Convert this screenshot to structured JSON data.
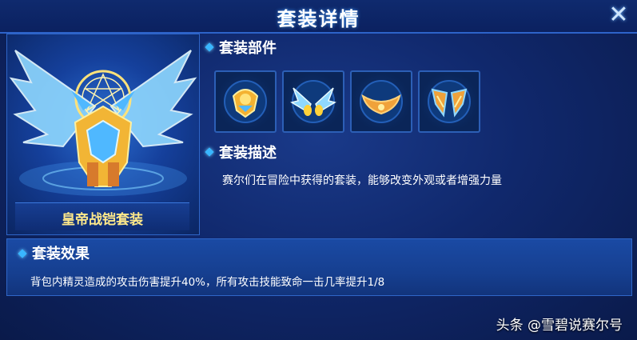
{
  "dialog": {
    "title": "套装详情",
    "close_icon": "close-icon"
  },
  "hero": {
    "suit_name": "皇帝战铠套装",
    "accent": "#ffe98a"
  },
  "parts_section": {
    "title": "套装部件",
    "parts": [
      {
        "icon": "helmet-icon"
      },
      {
        "icon": "wings-icon"
      },
      {
        "icon": "cape-icon"
      },
      {
        "icon": "armor-wings-icon"
      }
    ]
  },
  "description_section": {
    "title": "套装描述",
    "text": "赛尔们在冒险中获得的套装，能够改变外观或者增强力量"
  },
  "effects_section": {
    "title": "套装效果",
    "text": "背包内精灵造成的攻击伤害提升40%，所有攻击技能致命一击几率提升1/8"
  },
  "watermark": "头条 @雪碧说赛尔号",
  "colors": {
    "background": "#0c1f52",
    "panel": "#163f90",
    "border": "#2f66c8",
    "diamond": "#39b6ff"
  }
}
